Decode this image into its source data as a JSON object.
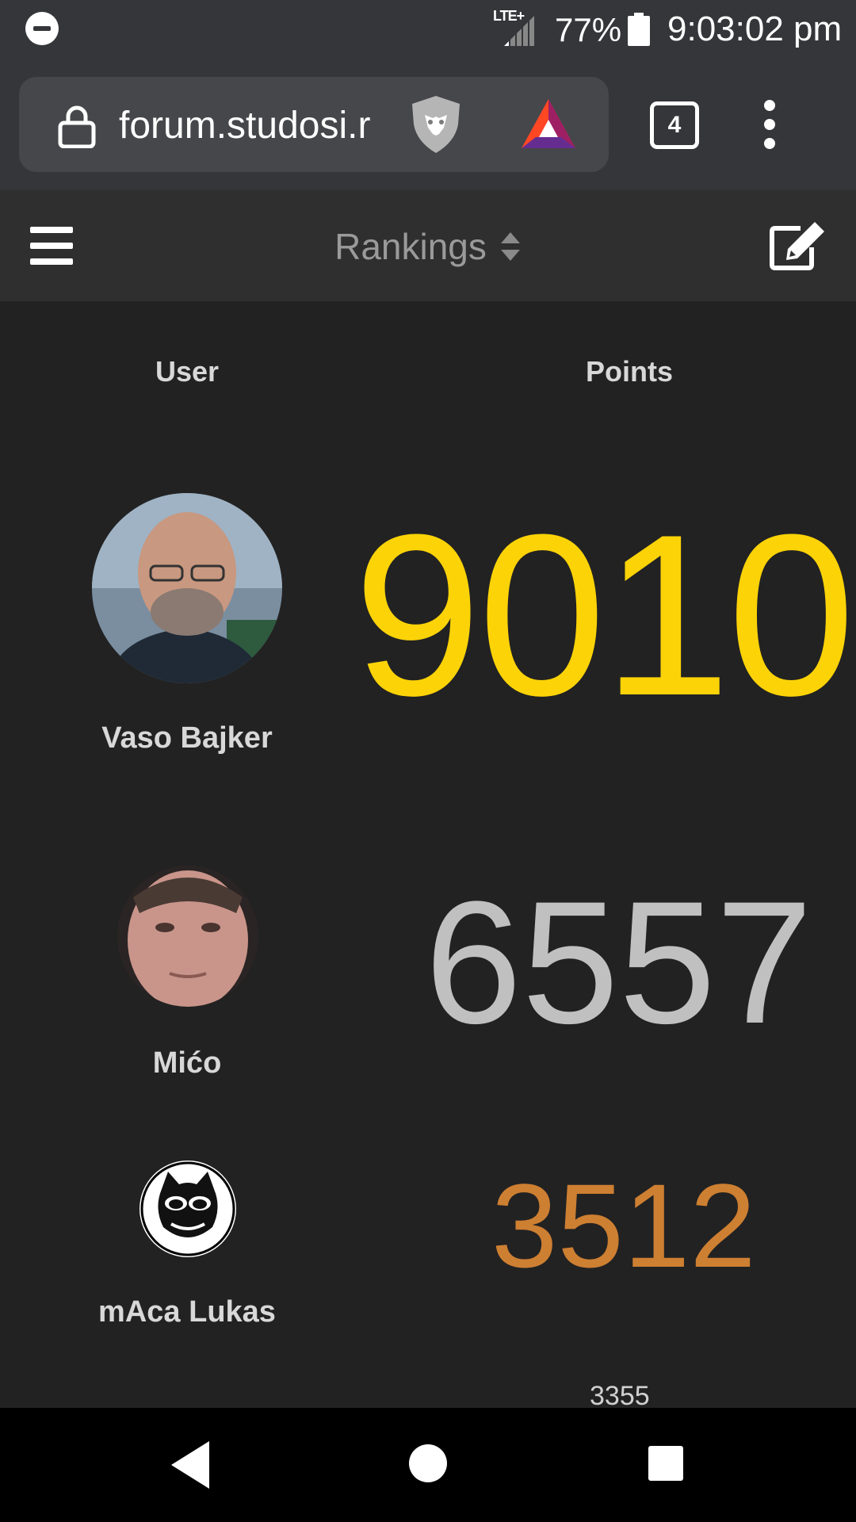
{
  "status_bar": {
    "network": "LTE+",
    "battery": "77%",
    "time": "9:03:02 pm",
    "icons": [
      "do-not-disturb-icon",
      "signal-icon",
      "battery-icon"
    ]
  },
  "browser": {
    "url": "forum.studosi.r",
    "tab_count": "4",
    "icons": [
      "lock-icon",
      "brave-shields-icon",
      "bat-rewards-icon",
      "more-vert-icon"
    ]
  },
  "header": {
    "title": "Rankings",
    "icons": [
      "hamburger-icon",
      "sort-icon",
      "compose-icon"
    ]
  },
  "rankings": {
    "columns": {
      "user": "User",
      "points": "Points"
    },
    "rows": [
      {
        "name": "Vaso Bajker",
        "points": "9010",
        "color": "#fcd307"
      },
      {
        "name": "Mićo",
        "points": "6557",
        "color": "#c0c0c0"
      },
      {
        "name": "mAca Lukas",
        "points": "3512",
        "color": "#cd7f32"
      },
      {
        "name": "",
        "points": "3355",
        "color": "#d0d0d0"
      }
    ]
  },
  "nav_bar": {
    "icons": [
      "back-icon",
      "home-icon",
      "recents-icon"
    ]
  }
}
